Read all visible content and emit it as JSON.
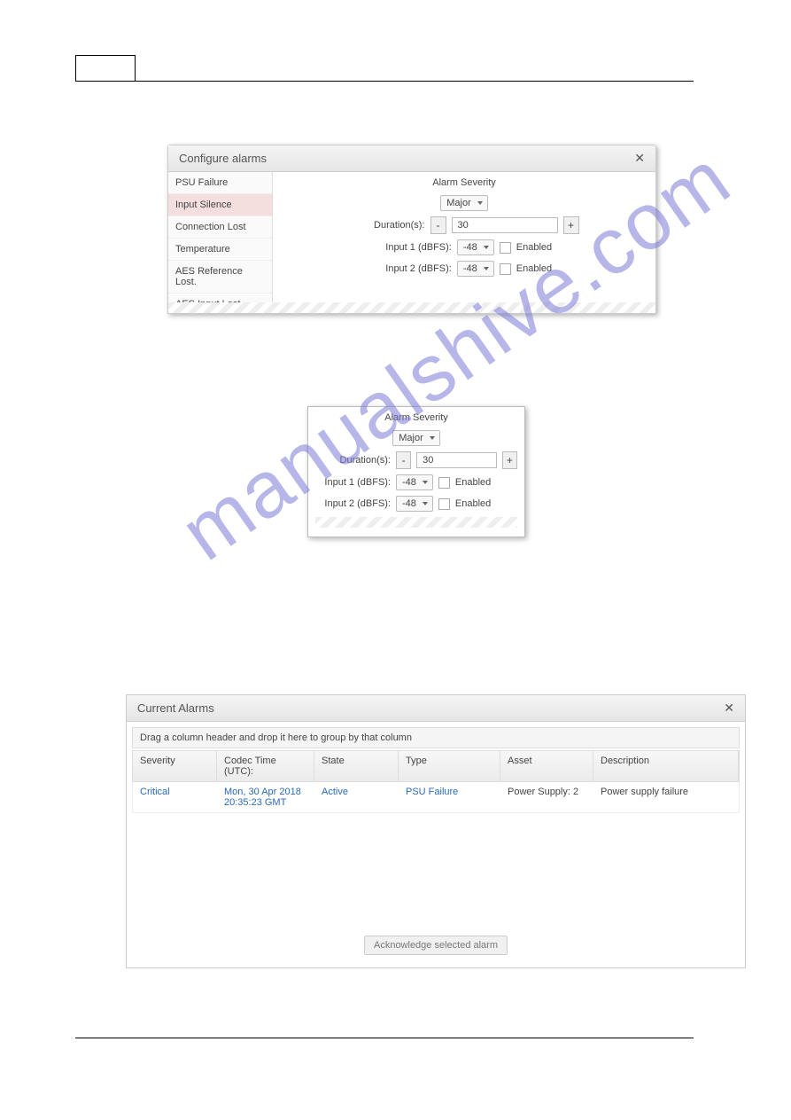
{
  "watermark": "manualshive.com",
  "panel1": {
    "title": "Configure alarms",
    "sidebar": [
      "PSU Failure",
      "Input Silence",
      "Connection Lost",
      "Temperature",
      "AES Reference Lost.",
      "AES Input Lost"
    ],
    "selected_index": 1,
    "severity_label": "Alarm Severity",
    "severity_value": "Major",
    "duration_label": "Duration(s):",
    "duration_value": "30",
    "input1_label": "Input 1 (dBFS):",
    "input1_value": "-48",
    "input2_label": "Input 2 (dBFS):",
    "input2_value": "-48",
    "enabled_label": "Enabled",
    "minus": "-",
    "plus": "+"
  },
  "panel2": {
    "severity_label": "Alarm Severity",
    "severity_value": "Major",
    "duration_label": "Duration(s):",
    "duration_value": "30",
    "input1_label": "Input 1 (dBFS):",
    "input1_value": "-48",
    "input2_label": "Input 2 (dBFS):",
    "input2_value": "-48",
    "enabled_label": "Enabled",
    "minus": "-",
    "plus": "+"
  },
  "panel3": {
    "title": "Current Alarms",
    "group_hint": "Drag a column header and drop it here to group by that column",
    "headers": {
      "sev": "Severity",
      "time": "Codec Time (UTC):",
      "state": "State",
      "type": "Type",
      "asset": "Asset",
      "desc": "Description"
    },
    "row": {
      "sev": "Critical",
      "time": "Mon, 30 Apr 2018 20:35:23 GMT",
      "state": "Active",
      "type": "PSU Failure",
      "asset": "Power Supply: 2",
      "desc": "Power supply failure"
    },
    "ack_label": "Acknowledge selected alarm"
  }
}
